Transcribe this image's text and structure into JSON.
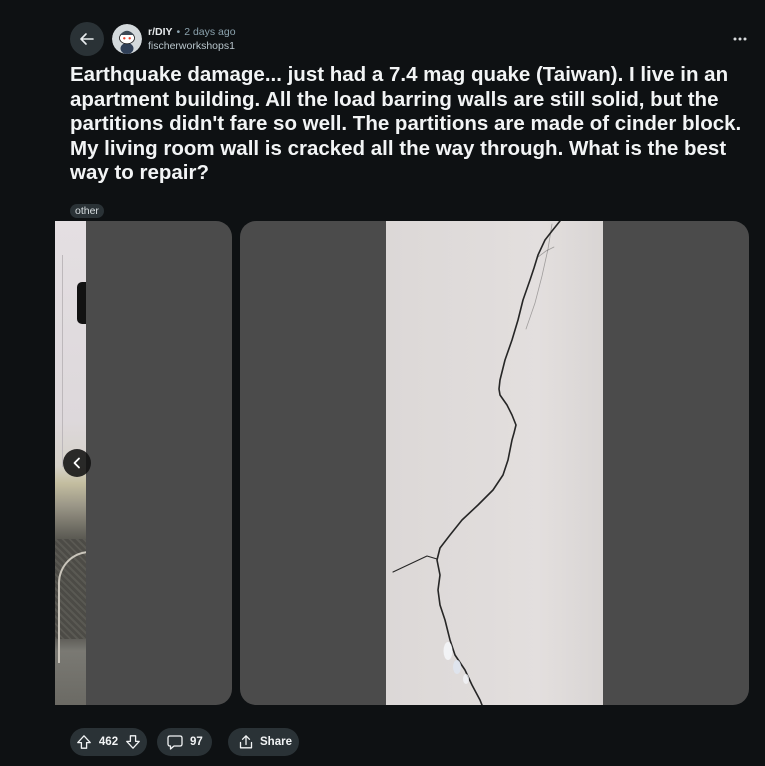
{
  "header": {
    "back_icon": "arrow-left-icon",
    "subreddit_avatar_icon": "subreddit-avatar-icon",
    "subreddit": "r/DIY",
    "separator": "•",
    "time_ago": "2 days ago",
    "author": "fischerworkshops1",
    "more_icon": "more-horizontal-icon"
  },
  "post": {
    "title": "Earthquake damage... just had a 7.4 mag quake (Taiwan). I live in an apartment building. All the load barring walls are still solid, but the partitions didn't fare so well. The partitions are made of cinder block. My living room wall is cracked all the way through. What is the best way to repair?",
    "flair": "other"
  },
  "gallery": {
    "prev_icon": "chevron-left-icon"
  },
  "actions": {
    "upvote_icon": "arrow-up-icon",
    "score": "462",
    "downvote_icon": "arrow-down-icon",
    "comment_icon": "comment-icon",
    "comment_count": "97",
    "share_icon": "share-icon",
    "share_label": "Share"
  },
  "colors": {
    "background": "#0e1113",
    "button": "#2a3236",
    "text_primary": "#f2f4f5",
    "text_secondary": "#8ba2ad",
    "media_placeholder": "#4b4b4b",
    "wall": "#e0dcdb",
    "crack": "#262626"
  }
}
